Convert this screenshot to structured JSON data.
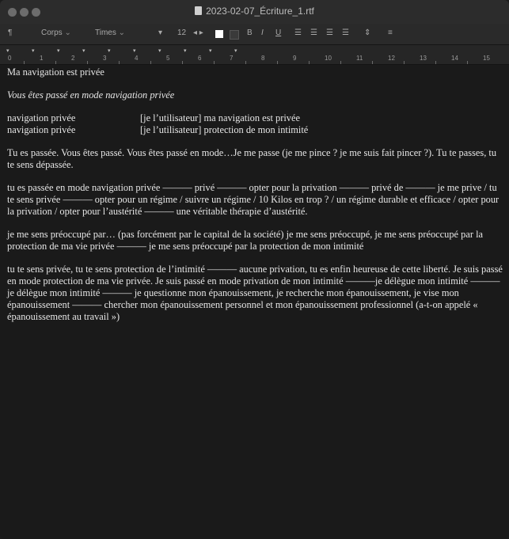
{
  "window": {
    "title": "2023-02-07_Écriture_1.rtf"
  },
  "toolbar": {
    "para_style": "Corps",
    "font_name": "Times",
    "font_size": "12",
    "color_swatch": "#ffffff",
    "items": [
      "B",
      "I",
      "U"
    ]
  },
  "ruler": {
    "labels": [
      "0",
      "1",
      "2",
      "3",
      "4",
      "5",
      "6",
      "7",
      "8",
      "9",
      "10",
      "11",
      "12",
      "13",
      "14",
      "15"
    ]
  },
  "document": {
    "heading": "Ma navigation est privée",
    "intro": "Vous êtes passé en mode navigation privée",
    "rows": [
      {
        "col1": "navigation privée",
        "col2": "[je l’utilisateur] ma navigation est privée"
      },
      {
        "col1": "navigation privée",
        "col2": "[je l’utilisateur] protection de mon intimité"
      }
    ],
    "p1": "Tu es passée. Vous êtes passé. Vous êtes passé en mode…Je me passe (je me pince ? je me suis fait pincer ?). Tu te passes, tu te sens dépassée.",
    "p2": "tu es passée en mode navigation privée ——— privé ——— opter pour la privation ——— privé de ——— je me prive / tu te sens privée ——— opter pour un régime / suivre un régime / 10 Kilos en trop ? / un régime durable et efficace / opter pour la privation / opter pour l’austérité ——— une véritable thérapie d’austérité.",
    "p3": "je me sens préoccupé par… (pas forcément par le capital de la société) je me sens préoccupé, je me sens préoccupé par la protection de ma vie privée ——— je me sens préoccupé par la protection de mon intimité",
    "p4": "tu te sens privée, tu te sens protection de l’intimité ——— aucune privation, tu es enfin heureuse de cette liberté. Je suis passé en mode protection de ma vie privée. Je suis passé en mode privation de mon intimité ———je délègue mon intimité ——— je délègue mon intimité ——— je questionne mon épanouissement, je recherche mon épanouissement, je vise mon épanouissement ——— chercher mon épanouissement personnel et mon épanouissement professionnel (a-t-on appelé « épanouissement au travail »)"
  }
}
